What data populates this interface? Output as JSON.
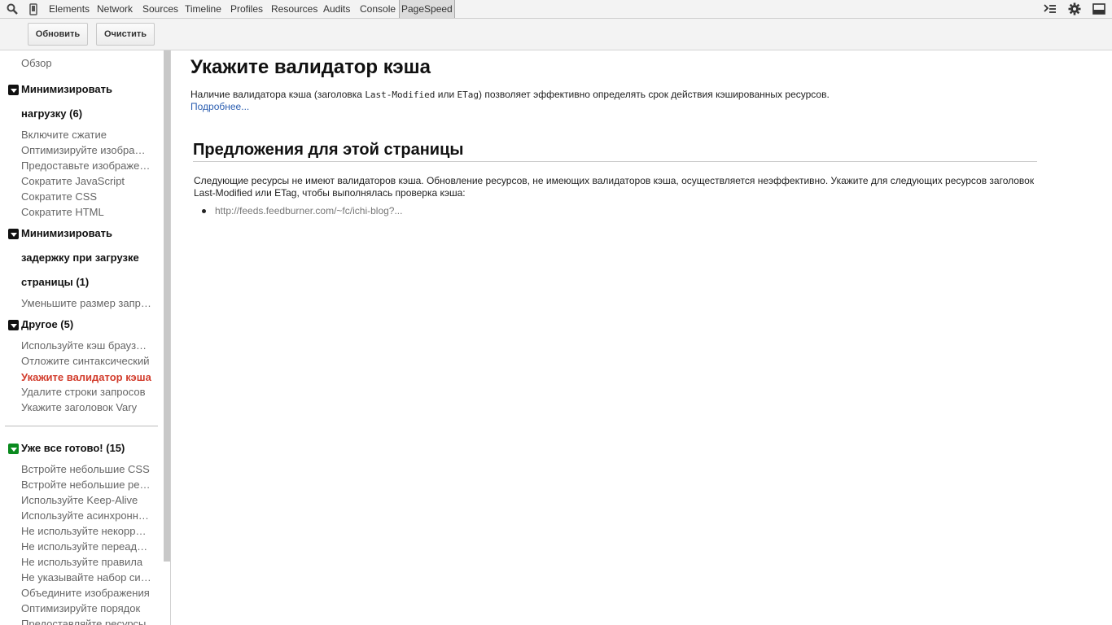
{
  "topbar": {
    "tabs": [
      "Elements",
      "Network",
      "Sources",
      "Timeline",
      "Profiles",
      "Resources",
      "Audits",
      "Console",
      "PageSpeed"
    ],
    "selected": "PageSpeed"
  },
  "toolbar": {
    "refresh_label": "Обновить",
    "clear_label": "Очистить"
  },
  "sidebar": {
    "overview": "Обзор",
    "groups": [
      {
        "title_lines": [
          "Минимизировать",
          "нагрузку (6)"
        ],
        "items": [
          "Включите сжатие",
          "Оптимизируйте изображения",
          "Предоставьте изображения",
          "Сократите JavaScript",
          "Сократите CSS",
          "Сократите HTML"
        ]
      },
      {
        "title_lines": [
          "Минимизировать",
          "задержку при загрузке",
          "страницы (1)"
        ],
        "items": [
          "Уменьшите размер запросов"
        ]
      },
      {
        "title_lines": [
          "Другое (5)"
        ],
        "items": [
          "Используйте кэш браузера",
          "Отложите синтаксический",
          "Укажите валидатор кэша",
          "Удалите строки запросов",
          "Укажите заголовок Vary"
        ]
      },
      {
        "title_lines": [
          "Уже все готово! (15)"
        ],
        "items": [
          "Встройте небольшие CSS",
          "Встройте небольшие ресурсы",
          "Используйте Keep-Alive",
          "Используйте асинхронные",
          "Не используйте некорректные",
          "Не используйте переадресацию",
          "Не используйте правила",
          "Не указывайте набор символов",
          "Объедините изображения",
          "Оптимизируйте порядок",
          "Предоставляйте ресурсы"
        ]
      }
    ]
  },
  "main": {
    "title": "Укажите валидатор кэша",
    "intro_before": "Наличие валидатора кэша (заголовка ",
    "intro_code1": "Last-Modified",
    "intro_mid": " или ",
    "intro_code2": "ETag",
    "intro_after": ") позволяет эффективно определять срок действия кэшированных ресурсов.",
    "more_link": "Подробнее...",
    "section_title": "Предложения для этой страницы",
    "section_desc": "Следующие ресурсы не имеют валидаторов кэша. Обновление ресурсов, не имеющих валидаторов кэша, осуществляется неэффективно. Укажите для следующих ресурсов заголовок Last-Modified или ETag, чтобы выполнялась проверка кэша:",
    "resources": [
      "http://feeds.feedburner.com/~fc/ichi-blog?..."
    ]
  }
}
